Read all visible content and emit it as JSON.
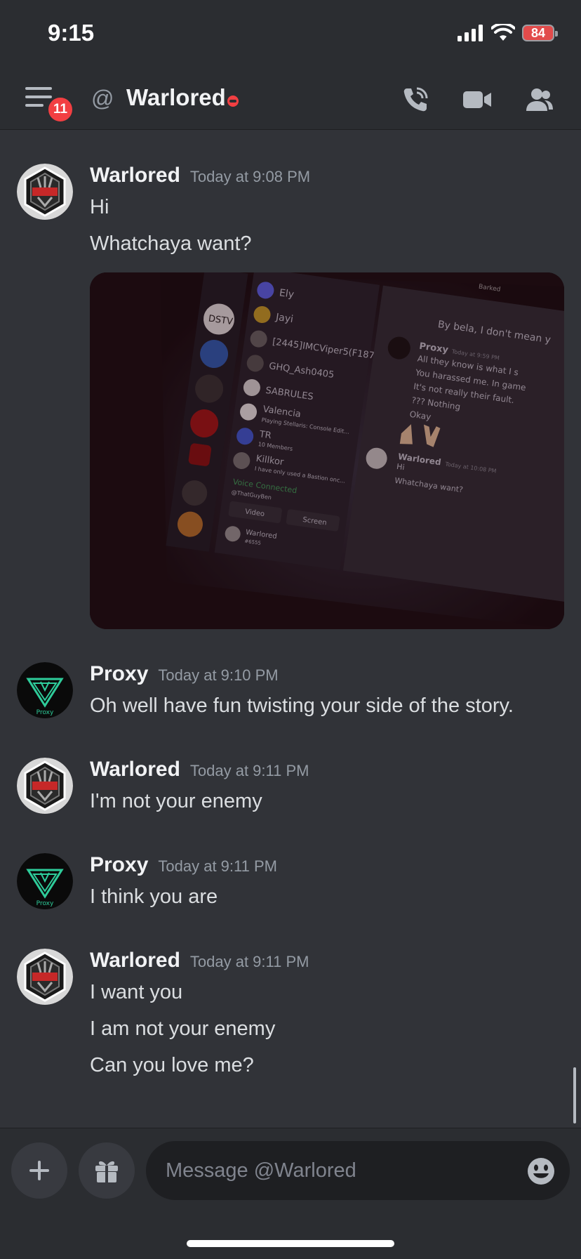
{
  "status_bar": {
    "time": "9:15",
    "battery": "84"
  },
  "header": {
    "badge_count": "11",
    "at_symbol": "@",
    "title": "Warlored",
    "status": "dnd"
  },
  "messages": [
    {
      "author": "Warlored",
      "timestamp": "Today at 9:08 PM",
      "lines": [
        "Hi",
        "Whatchaya want?"
      ],
      "avatar": "warlored-avatar",
      "has_image": true
    },
    {
      "author": "Proxy",
      "timestamp": "Today at 9:10 PM",
      "lines": [
        "Oh well have fun twisting your side of the story."
      ],
      "avatar": "proxy-avatar"
    },
    {
      "author": "Warlored",
      "timestamp": "Today at 9:11 PM",
      "lines": [
        "I'm not your enemy"
      ],
      "avatar": "warlored-avatar"
    },
    {
      "author": "Proxy",
      "timestamp": "Today at 9:11 PM",
      "lines": [
        "I think you are"
      ],
      "avatar": "proxy-avatar"
    },
    {
      "author": "Warlored",
      "timestamp": "Today at 9:11 PM",
      "lines": [
        "I want you",
        "I am not your enemy",
        "Can you love me?"
      ],
      "avatar": "warlored-avatar"
    }
  ],
  "attachment_photo": {
    "server_members": [
      "Ely",
      "Jayi",
      "[2445]IMCViper5(F187)",
      "GHQ_Ash0405",
      "SABRULES",
      "Valencia",
      "TR",
      "Killkor"
    ],
    "member_subtext": [
      "Playing Stellaris: Console Edit...",
      "10 Members",
      "I have only used a Bastion onc..."
    ],
    "voice_connected": "Voice Connected",
    "voice_user": "@ThatGuyBen",
    "video_label": "Video",
    "screen_label": "Screen",
    "bottom_user": "Warlored",
    "bottom_tag": "#6555",
    "chat_header_text": "By bela, I don't mean y",
    "chat_author": "Proxy",
    "chat_time": "Today at 9:59 PM",
    "chat_lines": [
      "All they know is what I s",
      "You harassed me. In game",
      "It's not really their fault.",
      "??? Nothing",
      "Okay"
    ],
    "chat_author2": "Warlored",
    "chat_time2": "Today at 10:08 PM",
    "chat_lines2": [
      "Hi",
      "Whatchaya want?"
    ],
    "server_icon_text": "DSTV",
    "side_text": "Barked"
  },
  "composer": {
    "placeholder": "Message @Warlored"
  },
  "colors": {
    "background": "#313338",
    "header": "#2b2d31",
    "input": "#1e1f22",
    "dnd": "#f23f42",
    "badge": "#f23f42"
  }
}
